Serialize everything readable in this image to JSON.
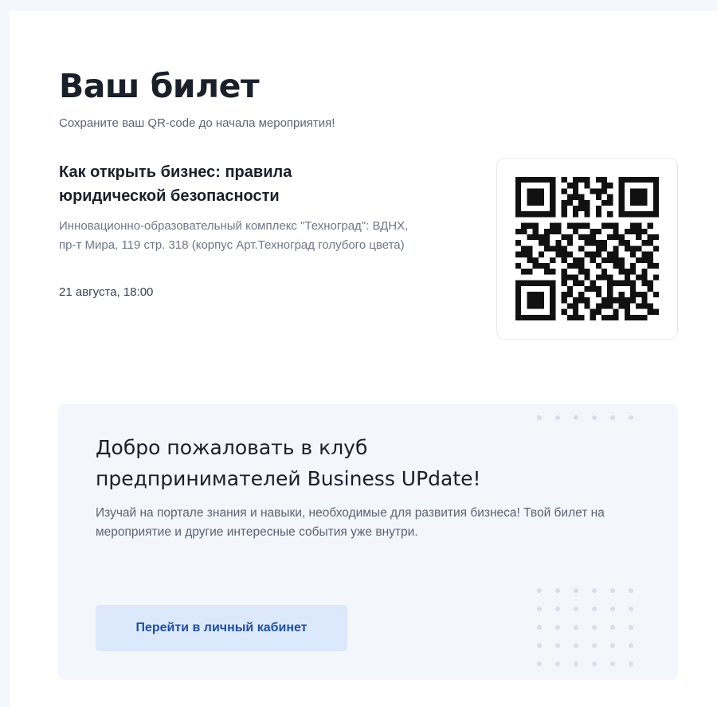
{
  "ticket": {
    "title": "Ваш билет",
    "subtitle": "Сохраните ваш QR-code до начала мероприятия!"
  },
  "event": {
    "title": "Как открыть бизнес: правила юридической безопасности",
    "address": "Инновационно-образовательный комплекс \"Техноград\": ВДНХ, пр-т Мира, 119 стр. 318 (корпус Арт.Техноград голубого цвета)",
    "date": "21 августа, 18:00"
  },
  "qr": {
    "icon": "qr-code-icon"
  },
  "promo": {
    "title": "Добро пожаловать в клуб предпринимателей Business UPdate!",
    "text": "Изучай на портале знания и навыки, необходимые для развития бизнеса! Твой билет на мероприятие и другие интересные события уже внутри.",
    "button_label": "Перейти в личный кабинет"
  },
  "colors": {
    "page_background": "#f4f7fb",
    "card_background": "#ffffff",
    "promo_background": "#f3f6fb",
    "button_background": "#dce8fb",
    "button_text": "#1f4fa3",
    "heading_text": "#1b1f2a"
  }
}
